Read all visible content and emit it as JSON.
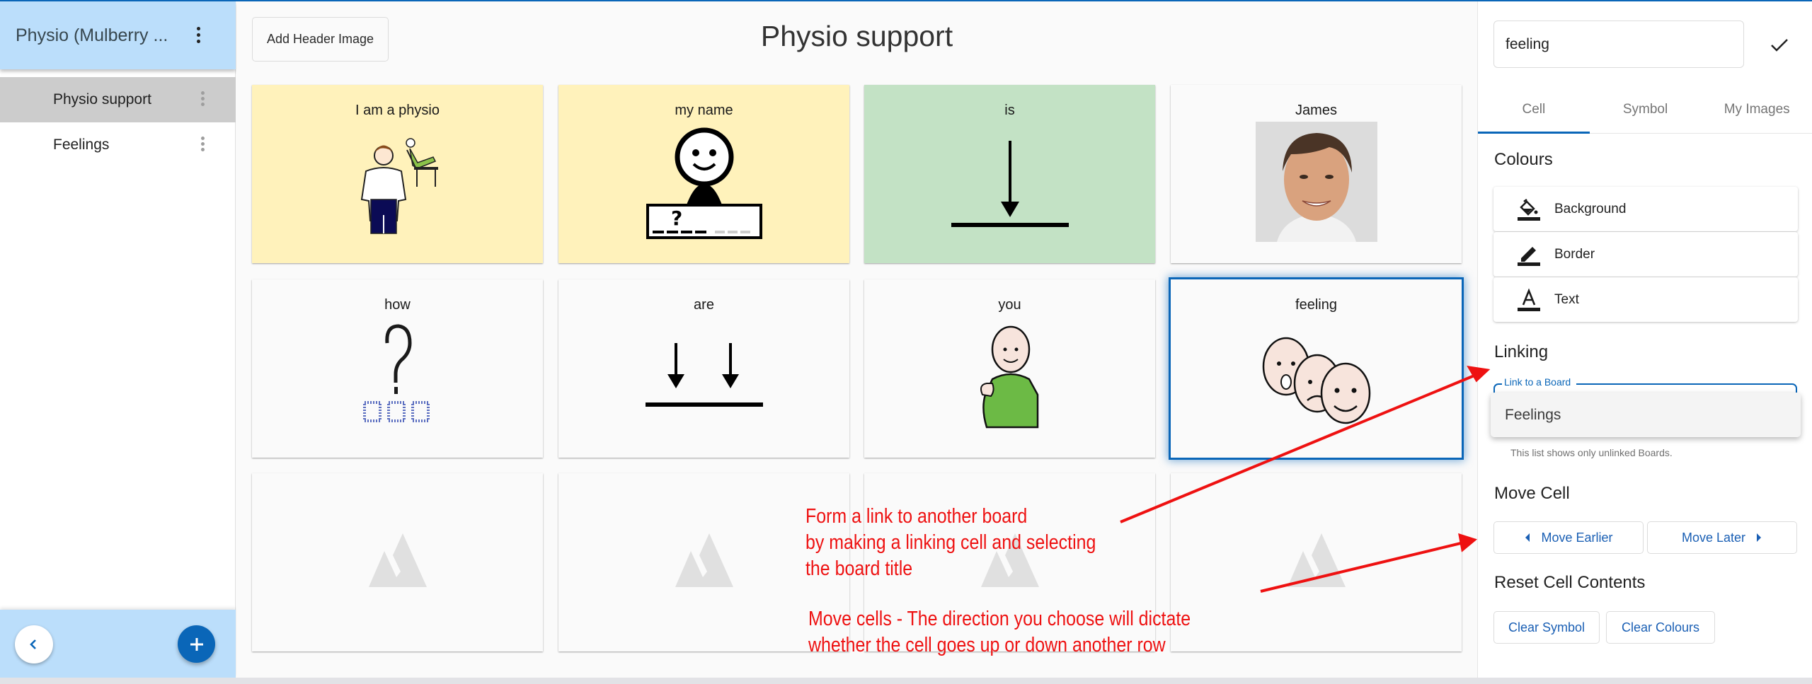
{
  "sidebar": {
    "project_title": "Physio (Mulberry ...",
    "boards": [
      {
        "label": "Physio support",
        "active": true
      },
      {
        "label": "Feelings",
        "active": false
      }
    ],
    "back_button_icon": "chevron-left-icon",
    "add_button_icon": "plus-icon"
  },
  "main": {
    "add_header_image_label": "Add Header Image",
    "board_title": "Physio support",
    "cells": [
      {
        "label": "I am a physio",
        "symbol": "physio-symbol",
        "background": "#fff2bb"
      },
      {
        "label": "my name",
        "symbol": "name-symbol",
        "background": "#fff2bb"
      },
      {
        "label": "is",
        "symbol": "is-arrow-symbol",
        "background": "#c3e2c5"
      },
      {
        "label": "James",
        "symbol": "person-photo",
        "background": "#fafafa"
      },
      {
        "label": "how",
        "symbol": "question-symbol",
        "background": "#fafafa"
      },
      {
        "label": "are",
        "symbol": "are-arrows-symbol",
        "background": "#fafafa"
      },
      {
        "label": "you",
        "symbol": "you-pointing-symbol",
        "background": "#fafafa"
      },
      {
        "label": "feeling",
        "symbol": "feelings-faces-symbol",
        "background": "#fafafa",
        "selected": true
      },
      {
        "label": "",
        "symbol": "placeholder-image-icon",
        "background": "#fafafa"
      },
      {
        "label": "",
        "symbol": "placeholder-image-icon",
        "background": "#fafafa"
      },
      {
        "label": "",
        "symbol": "placeholder-image-icon",
        "background": "#fafafa"
      },
      {
        "label": "",
        "symbol": "placeholder-image-icon",
        "background": "#fafafa"
      }
    ]
  },
  "panel": {
    "label_value": "feeling",
    "confirm_icon": "check-icon",
    "tabs": [
      {
        "label": "Cell",
        "active": true
      },
      {
        "label": "Symbol",
        "active": false
      },
      {
        "label": "My Images",
        "active": false
      }
    ],
    "colours_title": "Colours",
    "colour_options": [
      {
        "label": "Background",
        "icon": "paint-bucket-icon"
      },
      {
        "label": "Border",
        "icon": "pencil-icon"
      },
      {
        "label": "Text",
        "icon": "text-color-icon"
      }
    ],
    "linking_title": "Linking",
    "link_field_label": "Link to a Board",
    "link_options": [
      "Feelings"
    ],
    "link_helper": "This list shows only unlinked Boards.",
    "move_title": "Move Cell",
    "move_earlier_label": "Move Earlier",
    "move_later_label": "Move Later",
    "reset_title": "Reset Cell Contents",
    "clear_symbol_label": "Clear Symbol",
    "clear_colours_label": "Clear Colours"
  },
  "annotations": {
    "link_note": [
      "Form a link to another board",
      "by making a linking cell and selecting",
      "the board title"
    ],
    "move_note": [
      "Move cells - The direction you choose will dictate",
      "whether the cell goes up or down another row"
    ],
    "color": "#ee1111"
  },
  "theme": {
    "accent": "#0a66b8",
    "sidebar_header_bg": "#bbdefb",
    "active_board_bg": "#cccccc"
  }
}
